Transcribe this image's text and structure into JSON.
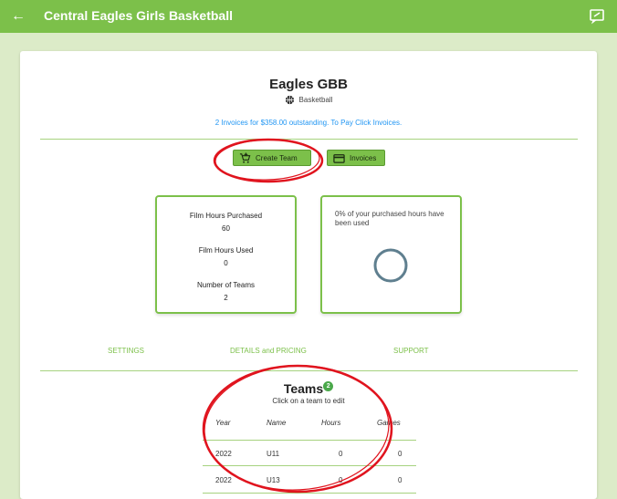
{
  "header": {
    "title": "Central Eagles Girls Basketball"
  },
  "org": {
    "name": "Eagles GBB",
    "sport": "Basketball",
    "invoice_message": "2 Invoices for $358.00 outstanding. To Pay Click Invoices."
  },
  "actions": {
    "create_team": "Create Team",
    "invoices": "Invoices"
  },
  "stats": {
    "film_purchased_label": "Film Hours Purchased",
    "film_purchased_value": "60",
    "film_used_label": "Film Hours Used",
    "film_used_value": "0",
    "teams_label": "Number of Teams",
    "teams_value": "2"
  },
  "usage": {
    "text": "0% of your purchased hours have been used",
    "percent": 0
  },
  "nav": {
    "settings": "SETTINGS",
    "details": "DETAILS and PRICING",
    "support": "SUPPORT"
  },
  "teams": {
    "title": "Teams",
    "count": "2",
    "subtitle": "Click on a team to edit",
    "columns": [
      "Year",
      "Name",
      "Hours",
      "Games"
    ],
    "rows": [
      [
        "2022",
        "U11",
        "0",
        "0"
      ],
      [
        "2022",
        "U13",
        "0",
        "0"
      ]
    ]
  },
  "colors": {
    "brand": "#7cc04a",
    "link": "#2196f3",
    "annotation": "#e0141e"
  }
}
